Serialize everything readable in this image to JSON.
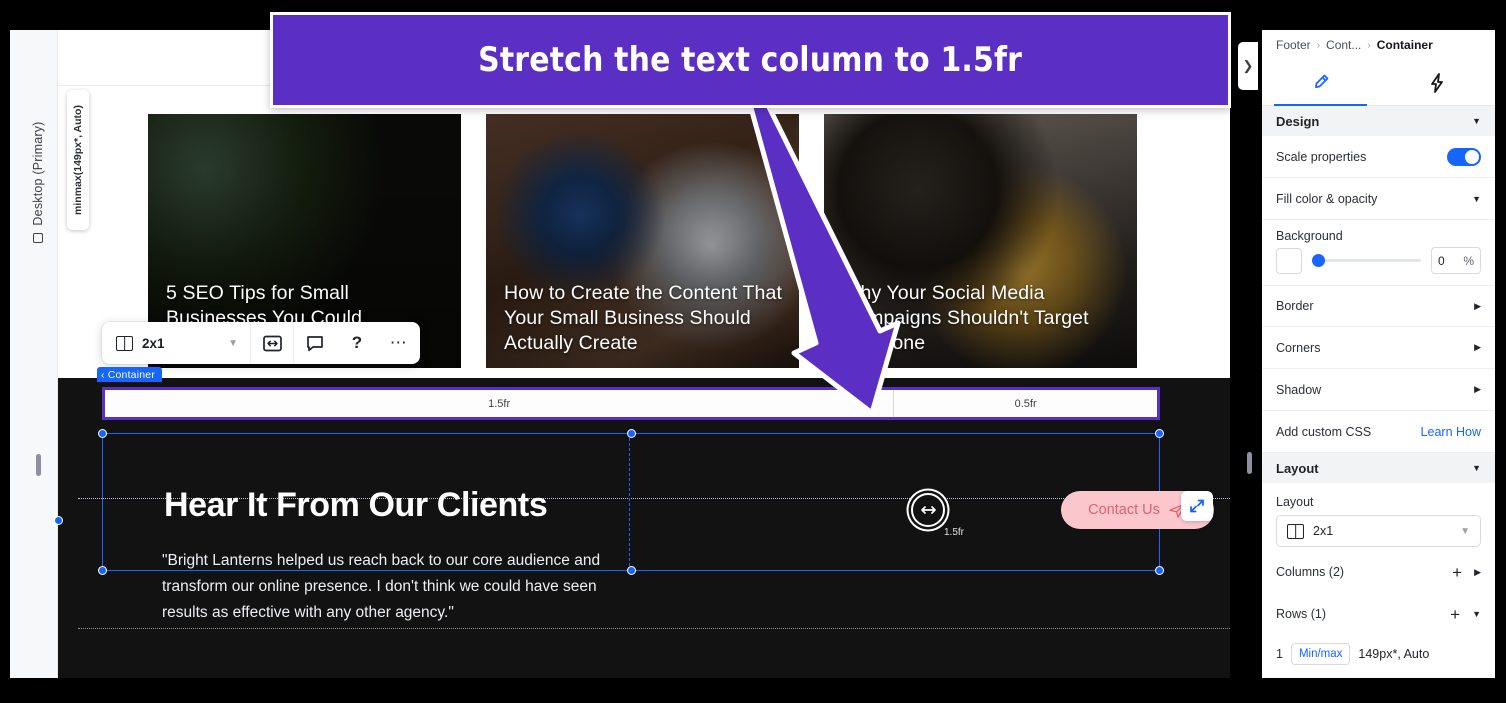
{
  "annotation": {
    "banner_text": "Stretch the text column to 1.5fr",
    "banner_color": "#5B2FC4",
    "arrow_icon": "down-right-arrow-icon"
  },
  "left_rail": {
    "device_label": "Desktop (Primary)",
    "device_icon": "monitor-icon"
  },
  "canvas": {
    "panel_toggle_icon": "chevron-right-icon",
    "blog_cards": [
      {
        "title": "5 SEO Tips for Small Businesses You Could Implement Right Now"
      },
      {
        "title": "How to Create the Content That Your Small Business Should Actually Create"
      },
      {
        "title": "Why Your Social Media Campaigns Shouldn't Target Everyone"
      }
    ],
    "floating_toolbar": {
      "layout_value": "2x1",
      "layout_icon": "two-column-grid-icon",
      "chevron_icon": "chevron-down-icon",
      "spacing_icon": "resize-spacing-icon",
      "comment_icon": "comment-bubble-icon",
      "help_icon": "question-mark-icon",
      "more_icon": "ellipsis-icon"
    },
    "container_badge": {
      "back_icon": "chevron-left-icon",
      "label": "Container"
    },
    "column_ruler": {
      "left_value": "1.5fr",
      "right_value": "0.5fr",
      "outline_color": "#5B2FC4"
    },
    "row_label": "minmax(149px*, Auto)",
    "drag_handle": {
      "icon": "horizontal-resize-icon",
      "tooltip": "1.5fr"
    },
    "footer_section": {
      "heading": "Hear It From Our Clients",
      "quote": "\"Bright Lanterns helped us reach back to our core audience and transform our online presence. I don't think we could have seen results as effective with any other agency.\"",
      "cta_label": "Contact Us",
      "cta_icon": "send-paper-plane-icon",
      "cta_bg": "#FBC7CD",
      "cta_text_color": "#E2606F",
      "expand_icon": "expand-diagonal-arrow-icon"
    }
  },
  "right_panel": {
    "breadcrumb": {
      "root": "Footer",
      "middle": "Cont...",
      "current": "Container",
      "separator": "›"
    },
    "tabs": [
      {
        "name": "design-tab",
        "icon": "paintbrush-icon",
        "active": true
      },
      {
        "name": "interactions-tab",
        "icon": "lightning-bolt-icon",
        "active": false
      }
    ],
    "design_header": "Design",
    "scale_properties": {
      "label": "Scale properties",
      "enabled": true,
      "color": "#1765FF"
    },
    "fill_section": {
      "label": "Fill color & opacity",
      "caret_icon": "caret-down-icon"
    },
    "background": {
      "label": "Background",
      "opacity_value": "0",
      "opacity_unit": "%"
    },
    "rows": [
      {
        "label": "Border",
        "caret_icon": "caret-right-icon"
      },
      {
        "label": "Corners",
        "caret_icon": "caret-right-icon"
      },
      {
        "label": "Shadow",
        "caret_icon": "caret-right-icon"
      }
    ],
    "custom_css": {
      "label": "Add custom CSS",
      "link": "Learn How"
    },
    "layout_section": {
      "header": "Layout",
      "caret_icon": "caret-down-icon",
      "layout_label": "Layout",
      "layout_value": "2x1",
      "layout_icon": "two-column-grid-icon",
      "columns_label": "Columns (2)",
      "rows_label": "Rows (1)",
      "add_icon": "plus-icon",
      "columns_caret": "caret-right-icon",
      "rows_caret": "caret-down-icon",
      "row_entry": {
        "index": "1",
        "badge": "Min/max",
        "value": "149px*, Auto"
      }
    }
  }
}
